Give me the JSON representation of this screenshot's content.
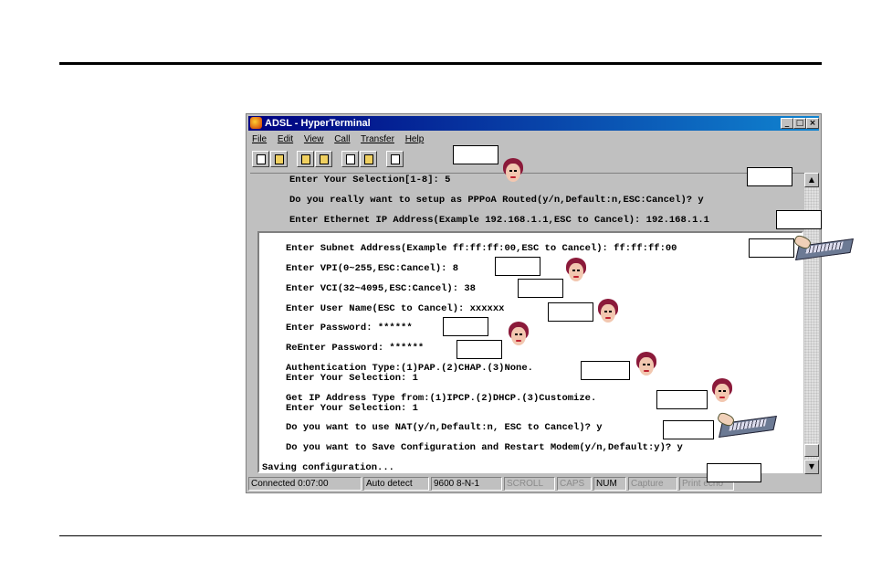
{
  "window": {
    "title": "ADSL - HyperTerminal",
    "controls": {
      "minimize": "_",
      "maximize": "□",
      "close": "×"
    }
  },
  "menu": {
    "items": [
      "File",
      "Edit",
      "View",
      "Call",
      "Transfer",
      "Help"
    ]
  },
  "toolbar": {
    "buttons": [
      "new-icon",
      "open-icon",
      "connect-icon",
      "disconnect-icon",
      "send-icon",
      "receive-icon",
      "properties-icon"
    ]
  },
  "terminal": {
    "top_lines": [
      "Enter Your Selection[1-8]: 5",
      "Do you really want to setup as PPPoA Routed(y/n,Default:n,ESC:Cancel)? y",
      "Enter Ethernet IP Address(Example 192.168.1.1,ESC to Cancel): 192.168.1.1"
    ],
    "main_lines": [
      "Enter Subnet Address(Example ff:ff:ff:00,ESC to Cancel): ff:ff:ff:00",
      "Enter VPI(0~255,ESC:Cancel): 8",
      "Enter VCI(32~4095,ESC:Cancel): 38",
      "Enter User Name(ESC to Cancel): xxxxxx",
      "Enter Password: ******",
      "ReEnter Password: ******",
      "Authentication Type:(1)PAP.(2)CHAP.(3)None.",
      "Enter Your Selection: 1",
      "Get IP Address Type from:(1)IPCP.(2)DHCP.(3)Customize.",
      "Enter Your Selection: 1",
      "Do you want to use NAT(y/n,Default:n, ESC to Cancel)? y",
      "Do you want to Save Configuration and Restart Modem(y/n,Default:y)? y",
      "Saving configuration..."
    ]
  },
  "scrollbar": {
    "up": "▲",
    "down": "▼"
  },
  "status": {
    "connected": "Connected 0:07:00",
    "detect": "Auto detect",
    "baud": "9600 8-N-1",
    "scroll": "SCROLL",
    "caps": "CAPS",
    "num": "NUM",
    "capture": "Capture",
    "print_echo": "Print echo"
  }
}
